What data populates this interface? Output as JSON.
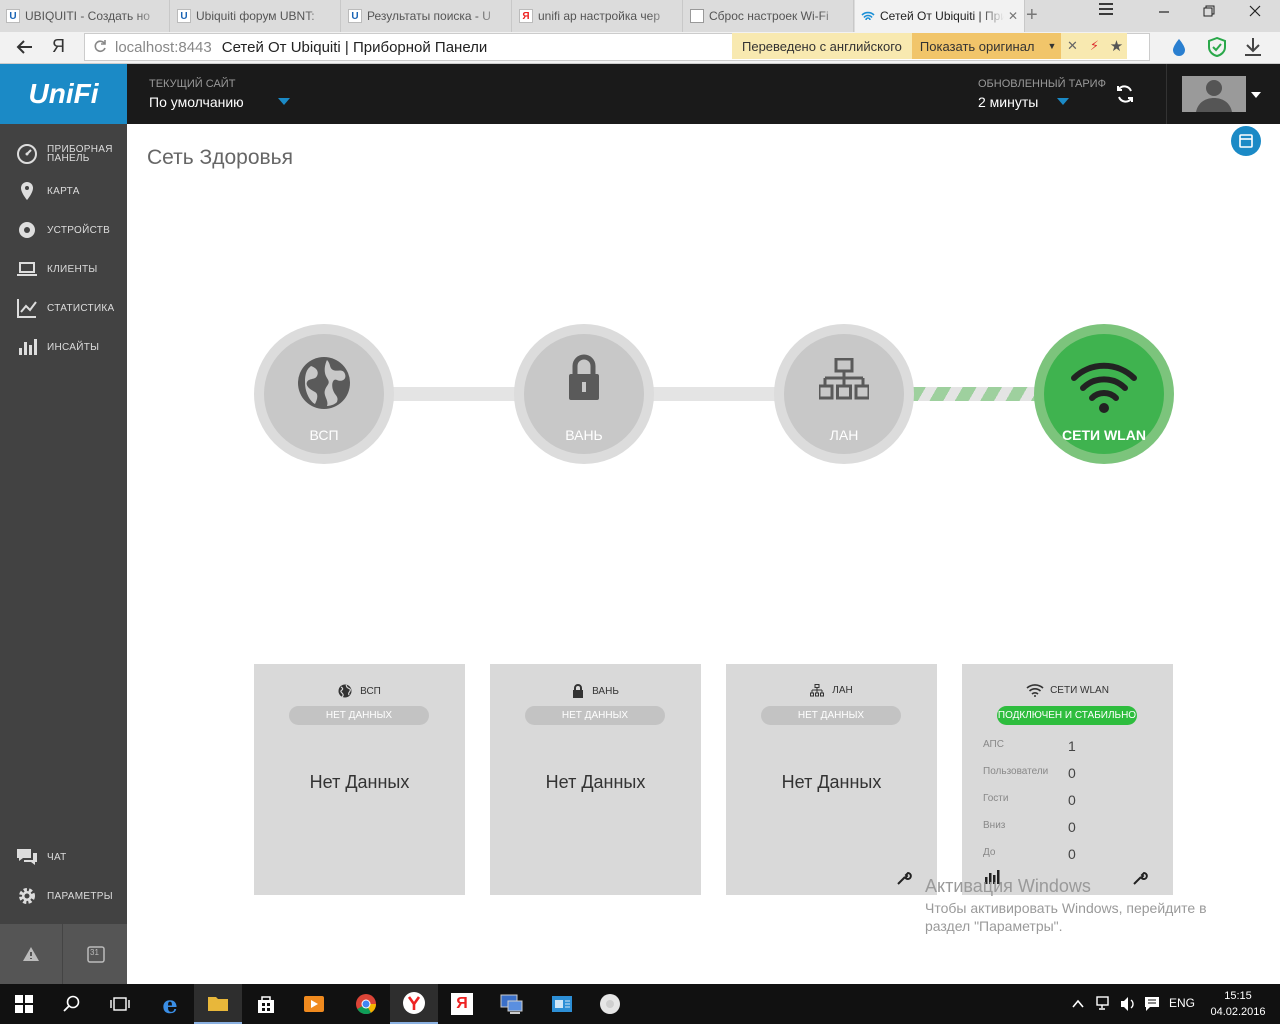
{
  "browser": {
    "tabs": [
      {
        "title": "UBIQUITI - Создать но",
        "icon": "ubiquiti-icon"
      },
      {
        "title": "Ubiquiti форум UBNT:",
        "icon": "ubiquiti-icon"
      },
      {
        "title": "Результаты поиска - U",
        "icon": "ubiquiti-icon"
      },
      {
        "title": "unifi ap настройка чер",
        "icon": "yandex-icon"
      },
      {
        "title": "Сброс настроек Wi-Fi",
        "icon": "document-icon"
      },
      {
        "title": "Сетей От Ubiquiti | При",
        "icon": "wifi-icon",
        "active": true
      }
    ],
    "address_host": "localhost:8443",
    "address_title": "Сетей От Ubiquiti | Приборной Панели",
    "translate_notice": "Переведено с английского",
    "show_original": "Показать оригинал"
  },
  "header": {
    "logo": "UniFi",
    "site_label": "ТЕКУЩИЙ САЙТ",
    "site_value": "По умолчанию",
    "refresh_label": "ОБНОВЛЕННЫЙ ТАРИФ",
    "refresh_value": "2 минуты"
  },
  "sidebar": {
    "items": [
      {
        "label": "ПРИБОРНАЯ ПАНЕЛЬ",
        "icon": "dashboard-icon"
      },
      {
        "label": "КАРТА",
        "icon": "map-pin-icon"
      },
      {
        "label": "УСТРОЙСТВ",
        "icon": "devices-icon"
      },
      {
        "label": "КЛИЕНТЫ",
        "icon": "laptop-icon"
      },
      {
        "label": "СТАТИСТИКА",
        "icon": "line-chart-icon"
      },
      {
        "label": "ИНСАЙТЫ",
        "icon": "bar-chart-icon"
      }
    ],
    "bottom_items": [
      {
        "label": "ЧАТ",
        "icon": "chat-icon"
      },
      {
        "label": "ПАРАМЕТРЫ",
        "icon": "gear-icon"
      }
    ],
    "calendar_day": "31"
  },
  "page": {
    "title": "Сеть Здоровья"
  },
  "health_nodes": [
    {
      "label": "ВСП",
      "icon": "globe-icon",
      "status": "none"
    },
    {
      "label": "ВАНЬ",
      "icon": "lock-icon",
      "status": "none"
    },
    {
      "label": "ЛАН",
      "icon": "network-icon",
      "status": "none"
    },
    {
      "label": "СЕТИ WLAN",
      "icon": "wifi-icon",
      "status": "ok"
    }
  ],
  "cards": [
    {
      "title": "ВСП",
      "badge": "НЕТ ДАННЫХ",
      "body": "Нет Данных"
    },
    {
      "title": "ВАНЬ",
      "badge": "НЕТ ДАННЫХ",
      "body": "Нет Данных"
    },
    {
      "title": "ЛАН",
      "badge": "НЕТ ДАННЫХ",
      "body": "Нет Данных"
    },
    {
      "title": "СЕТИ WLAN",
      "badge": "ПОДКЛЮЧЕН И СТАБИЛЬНО",
      "stats": [
        {
          "label": "АПС",
          "value": "1"
        },
        {
          "label": "Пользователи",
          "value": "0"
        },
        {
          "label": "Гости",
          "value": "0"
        },
        {
          "label": "Вниз",
          "value": "0"
        },
        {
          "label": "До",
          "value": "0"
        }
      ]
    }
  ],
  "watermark": {
    "title": "Активация Windows",
    "line1": "Чтобы активировать Windows, перейдите в",
    "line2": "раздел \"Параметры\"."
  },
  "taskbar": {
    "lang": "ENG",
    "time": "15:15",
    "date": "04.02.2016"
  },
  "colors": {
    "brand": "#1b8ac6",
    "ok": "#3fb34f",
    "sidebar": "#424242"
  }
}
